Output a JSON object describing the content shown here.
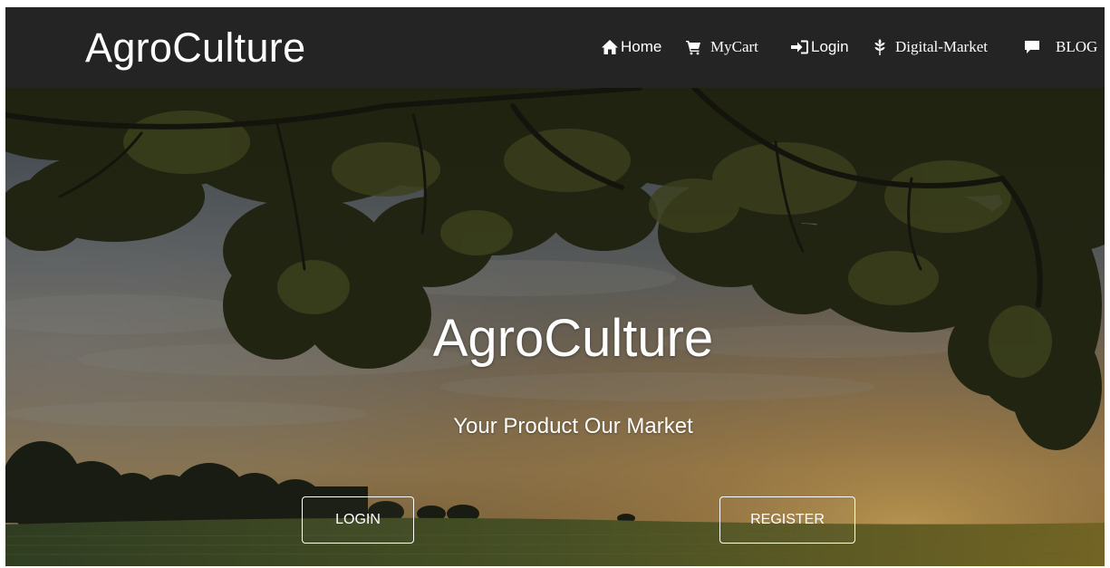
{
  "navbar": {
    "brand": "AgroCulture",
    "items": [
      {
        "label": "Home",
        "icon": "home-icon"
      },
      {
        "label": "MyCart",
        "icon": "cart-icon"
      },
      {
        "label": "Login",
        "icon": "login-icon"
      },
      {
        "label": "Digital-Market",
        "icon": "leaf-icon"
      },
      {
        "label": "BLOG",
        "icon": "comment-icon"
      }
    ]
  },
  "hero": {
    "title": "AgroCulture",
    "subtitle": "Your Product Our Market",
    "login_button": "LOGIN",
    "register_button": "REGISTER",
    "background": "trees-field-sunset-photo"
  },
  "colors": {
    "navbar_bg": "#242424",
    "text": "#ffffff",
    "button_border": "#ffffff"
  }
}
